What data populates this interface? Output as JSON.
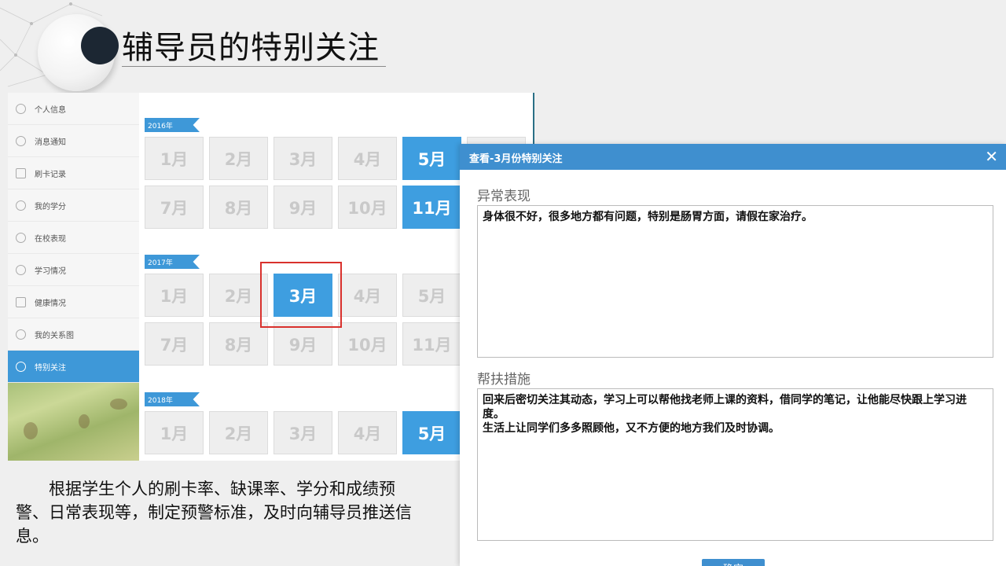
{
  "slide": {
    "title": "辅导员的特别关注",
    "description": "根据学生个人的刷卡率、缺课率、学分和成绩预警、日常表现等，制定预警标准，及时向辅导员推送信息。"
  },
  "sidebar": {
    "items": [
      {
        "label": "个人信息",
        "icon": "user-icon"
      },
      {
        "label": "消息通知",
        "icon": "message-icon"
      },
      {
        "label": "刷卡记录",
        "icon": "card-icon"
      },
      {
        "label": "我的学分",
        "icon": "medal-icon"
      },
      {
        "label": "在校表现",
        "icon": "eye-icon"
      },
      {
        "label": "学习情况",
        "icon": "book-icon"
      },
      {
        "label": "健康情况",
        "icon": "health-icon"
      },
      {
        "label": "我的关系图",
        "icon": "people-icon"
      },
      {
        "label": "特别关注",
        "icon": "heart-icon",
        "active": true
      }
    ]
  },
  "calendar": {
    "years": [
      {
        "year": "2016年",
        "months": [
          "1月",
          "2月",
          "3月",
          "4月",
          "5月",
          "",
          "7月",
          "8月",
          "9月",
          "10月",
          "11月"
        ],
        "highlighted": [
          "5月",
          "11月"
        ]
      },
      {
        "year": "2017年",
        "months": [
          "1月",
          "2月",
          "3月",
          "4月",
          "5月",
          "",
          "7月",
          "8月",
          "9月",
          "10月",
          "11月"
        ],
        "highlighted": [
          "3月"
        ]
      },
      {
        "year": "2018年",
        "months": [
          "1月",
          "2月",
          "3月",
          "4月",
          "5月"
        ],
        "highlighted": [
          "5月"
        ]
      }
    ]
  },
  "dialog": {
    "title": "查看-3月份特别关注",
    "close": "✕",
    "section1_label": "异常表现",
    "section1_text": "身体很不好，很多地方都有问题，特别是肠胃方面，请假在家治疗。",
    "section2_label": "帮扶措施",
    "section2_text": "回来后密切关注其动态，学习上可以帮他找老师上课的资料，借同学的笔记，让他能尽快跟上学习进度。\n生活上让同学们多多照顾他，又不方便的地方我们及时协调。",
    "confirm": "确定"
  },
  "colors": {
    "accent": "#3e98d8",
    "highlight_box": "#d9312d",
    "dark_circle": "#1c2733"
  }
}
